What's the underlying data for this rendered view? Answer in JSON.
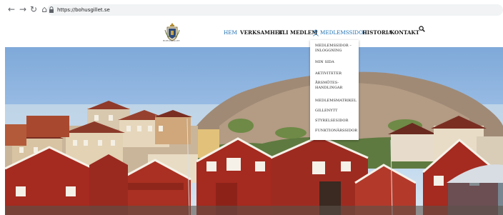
{
  "browser": {
    "back_icon": "back-arrow-icon",
    "forward_icon": "forward-arrow-icon",
    "reload_icon": "reload-icon",
    "home_icon": "home-icon",
    "url": "https://bohusgillet.se"
  },
  "site": {
    "logo_text": "BOHUSGILLET",
    "nav": [
      {
        "label": "HEM"
      },
      {
        "label": "VERKSAMHET"
      },
      {
        "label": "BLI MEDLEM"
      },
      {
        "label": "MEDLEMSSIDOR"
      },
      {
        "label": "HISTORIA"
      },
      {
        "label": "KONTAKT"
      }
    ],
    "colors": {
      "accent": "#1e6fb0",
      "text": "#1b1b1b"
    }
  },
  "dropdown": {
    "items": [
      {
        "label_1": "MEDLEMSSIDOR –",
        "label_2": "INLOGGNING"
      },
      {
        "label_1": "MIN SIDA"
      },
      {
        "label_1": "AKTIVITETER"
      },
      {
        "label_1": "ÅRSMÖTES-",
        "label_2": "HANDLINGAR"
      },
      {
        "label_1": "MEDLEMSMATRIKEL"
      },
      {
        "label_1": "GILLENYTT"
      },
      {
        "label_1": "STYRELSESIDOR"
      },
      {
        "label_1": "FUNKTIONÄRSSIDOR"
      }
    ]
  }
}
